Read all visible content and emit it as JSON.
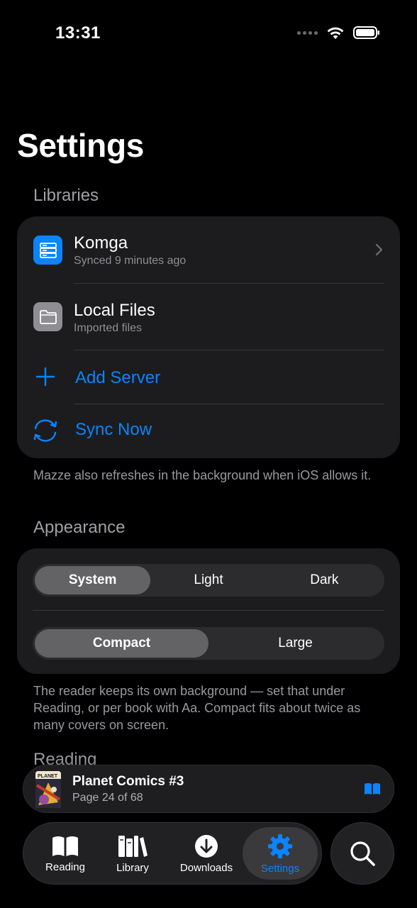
{
  "status": {
    "time": "13:31"
  },
  "page": {
    "title": "Settings"
  },
  "libraries": {
    "header": "Libraries",
    "komga": {
      "title": "Komga",
      "subtitle": "Synced 9 minutes ago"
    },
    "local": {
      "title": "Local Files",
      "subtitle": "Imported files"
    },
    "add_server": "Add Server",
    "sync_now": "Sync Now",
    "footer": "Mazze also refreshes in the background when iOS allows it."
  },
  "appearance": {
    "header": "Appearance",
    "theme": {
      "options": [
        "System",
        "Light",
        "Dark"
      ],
      "selected": "System"
    },
    "density": {
      "options": [
        "Compact",
        "Large"
      ],
      "selected": "Compact"
    },
    "footer": "The reader keeps its own background — set that under Reading, or per book with Aa. Compact fits about twice as many covers on screen."
  },
  "reading": {
    "header": "Reading"
  },
  "now_reading": {
    "title": "Planet Comics #3",
    "subtitle": "Page 24 of 68"
  },
  "tabs": [
    {
      "label": "Reading",
      "icon": "book-open-icon"
    },
    {
      "label": "Library",
      "icon": "books-icon"
    },
    {
      "label": "Downloads",
      "icon": "download-icon"
    },
    {
      "label": "Settings",
      "icon": "gear-icon"
    }
  ],
  "active_tab": "Settings",
  "colors": {
    "accent": "#0a84ff",
    "background": "#000000",
    "card": "#1c1c1e"
  }
}
